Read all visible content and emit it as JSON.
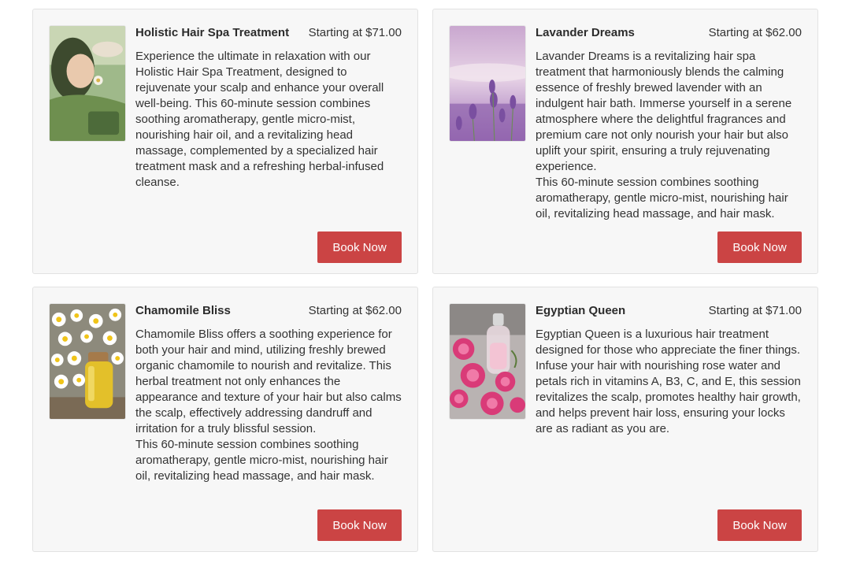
{
  "theme": {
    "button_color": "#cb4444",
    "card_background": "#f7f7f7"
  },
  "services": [
    {
      "title": "Holistic Hair Spa Treatment",
      "price": "Starting at $71.00",
      "image_icon": "spa-treatment-photo",
      "description": [
        "Experience the ultimate in relaxation with our Holistic Hair Spa Treatment, designed to rejuvenate your scalp and enhance your overall well-being. This 60-minute session combines soothing aromatherapy, gentle micro-mist, nourishing hair oil, and a revitalizing head massage, complemented by a specialized hair treatment mask and a refreshing herbal-infused cleanse."
      ],
      "button_label": "Book Now"
    },
    {
      "title": "Lavander Dreams",
      "price": "Starting at $62.00",
      "image_icon": "lavender-field-photo",
      "description": [
        "Lavander Dreams is a revitalizing hair spa treatment that harmoniously blends the calming essence of freshly brewed lavender with an indulgent hair bath. Immerse yourself in a serene atmosphere where the delightful fragrances and premium care not only nourish your hair but also uplift your spirit, ensuring a truly rejuvenating experience.",
        "This 60-minute session combines soothing aromatherapy, gentle micro-mist, nourishing hair oil, revitalizing head massage, and hair mask."
      ],
      "button_label": "Book Now"
    },
    {
      "title": "Chamomile Bliss",
      "price": "Starting at $62.00",
      "image_icon": "chamomile-oil-photo",
      "description": [
        "Chamomile Bliss offers a soothing experience for both your hair and mind, utilizing freshly brewed organic chamomile to nourish and revitalize. This herbal treatment not only enhances the appearance and texture of your hair but also calms the scalp, effectively addressing dandruff and irritation for a truly blissful session.",
        "This 60-minute session combines soothing aromatherapy, gentle micro-mist, nourishing hair oil, revitalizing head massage, and hair mask."
      ],
      "button_label": "Book Now"
    },
    {
      "title": "Egyptian Queen",
      "price": "Starting at $71.00",
      "image_icon": "rose-water-photo",
      "description": [
        "Egyptian Queen is a luxurious hair treatment designed for those who appreciate the finer things. Infuse your hair with nourishing rose water and petals rich in vitamins A, B3, C, and E, this session revitalizes the scalp, promotes healthy hair growth, and helps prevent hair loss, ensuring your locks are as radiant as you are."
      ],
      "button_label": "Book Now"
    }
  ]
}
